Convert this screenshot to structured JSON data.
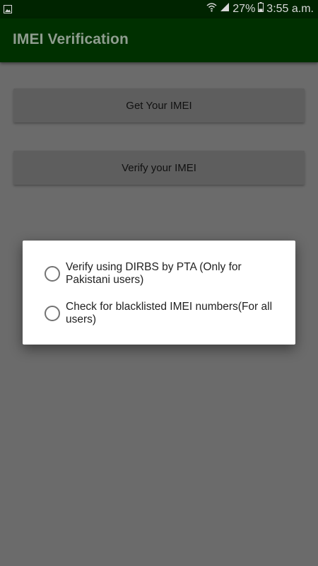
{
  "status_bar": {
    "battery": "27%",
    "time": "3:55 a.m.",
    "icons": [
      "gallery-icon",
      "wifi-icon",
      "signal-icon",
      "battery-icon"
    ]
  },
  "app_bar": {
    "title": "IMEI Verification"
  },
  "buttons": {
    "get_imei": "Get Your IMEI",
    "verify_imei": "Verify your IMEI"
  },
  "dialog": {
    "options": [
      {
        "label": "Verify using DIRBS by PTA (Only for Pakistani users)",
        "selected": false
      },
      {
        "label": "Check for blacklisted IMEI numbers(For all users)",
        "selected": false
      }
    ]
  },
  "colors": {
    "status_bar": "#002400",
    "app_bar": "#003000",
    "scrim": "#6b6b6b",
    "button": "#5e5e5e",
    "dialog": "#ffffff"
  }
}
